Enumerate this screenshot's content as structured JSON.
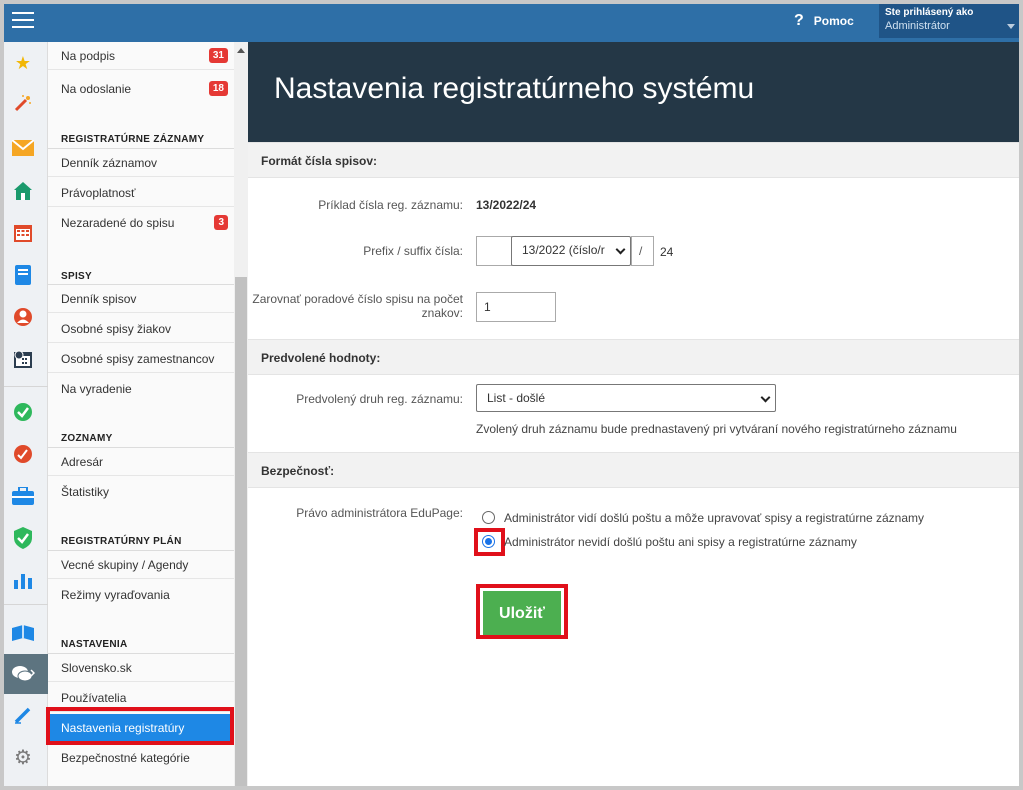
{
  "header": {
    "help_label": "Pomoc",
    "user_line1": "Ste prihlásený ako",
    "user_line2": "Administrátor"
  },
  "submenu": {
    "items_top": [
      {
        "label": "Na podpis",
        "badge": "31"
      },
      {
        "label": "Na odoslanie",
        "badge": "18"
      }
    ],
    "sections": [
      {
        "title": "REGISTRATÚRNE ZÁZNAMY",
        "items": [
          {
            "label": "Denník záznamov"
          },
          {
            "label": "Právoplatnosť"
          },
          {
            "label": "Nezaradené do spisu",
            "badge": "3"
          }
        ]
      },
      {
        "title": "SPISY",
        "items": [
          {
            "label": "Denník spisov"
          },
          {
            "label": "Osobné spisy žiakov"
          },
          {
            "label": "Osobné spisy zamestnancov"
          },
          {
            "label": "Na vyradenie"
          }
        ]
      },
      {
        "title": "ZOZNAMY",
        "items": [
          {
            "label": "Adresár"
          },
          {
            "label": "Štatistiky"
          }
        ]
      },
      {
        "title": "REGISTRATÚRNY PLÁN",
        "items": [
          {
            "label": "Vecné skupiny / Agendy"
          },
          {
            "label": "Režimy vyraďovania"
          }
        ]
      },
      {
        "title": "NASTAVENIA",
        "items": [
          {
            "label": "Slovensko.sk"
          },
          {
            "label": "Používatelia"
          },
          {
            "label": "Nastavenia registratúry"
          },
          {
            "label": "Bezpečnostné kategórie"
          }
        ]
      }
    ]
  },
  "main": {
    "title": "Nastavenia registratúrneho systému",
    "format_section": "Formát čísla spisov:",
    "example_label": "Príklad čísla reg. záznamu:",
    "example_value": "13/2022/24",
    "prefix_label": "Prefix / suffix čísla:",
    "prefix_select": "13/2022 (číslo/r",
    "slash": "/",
    "suffix_value": "24",
    "pad_label": "Zarovnať poradové číslo spisu na počet znakov:",
    "pad_value": "1",
    "defaults_section": "Predvolené hodnoty:",
    "default_type_label": "Predvolený druh reg. záznamu:",
    "default_type_value": "List - došlé",
    "default_type_note": "Zvolený druh záznamu bude prednastavený pri vytváraní nového registratúrneho záznamu",
    "security_section": "Bezpečnosť:",
    "admin_right_label": "Právo administrátora EduPage:",
    "radio1": "Administrátor vidí došlú poštu a môže upravovať spisy a registratúrne záznamy",
    "radio2": "Administrátor nevidí došlú poštu ani spisy a registratúrne záznamy",
    "save_label": "Uložiť"
  }
}
